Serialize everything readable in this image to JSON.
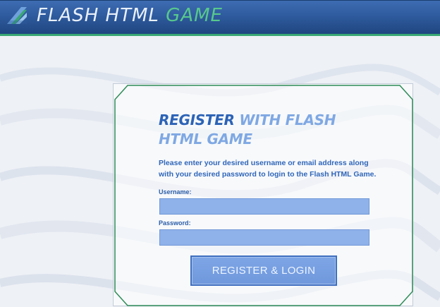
{
  "header": {
    "title_part1": "FLASH HTML",
    "title_part2": "GAME",
    "logo_icon": "flash-game-logo-icon"
  },
  "form": {
    "heading_part1": "REGISTER",
    "heading_part2": "WITH FLASH HTML GAME",
    "description": "Please enter your desired username or email address along with your desired password to login to the Flash HTML Game.",
    "username_label": "Username:",
    "username_value": "",
    "password_label": "Password:",
    "password_value": "",
    "submit_label": "REGISTER & LOGIN"
  },
  "colors": {
    "header_blue": "#2f5b9f",
    "accent_green": "#3aa874",
    "heading_blue": "#2c63b6",
    "heading_light_blue": "#7fa8e3",
    "field_fill": "#8fb2ea",
    "frame_green": "#2e8b57"
  }
}
